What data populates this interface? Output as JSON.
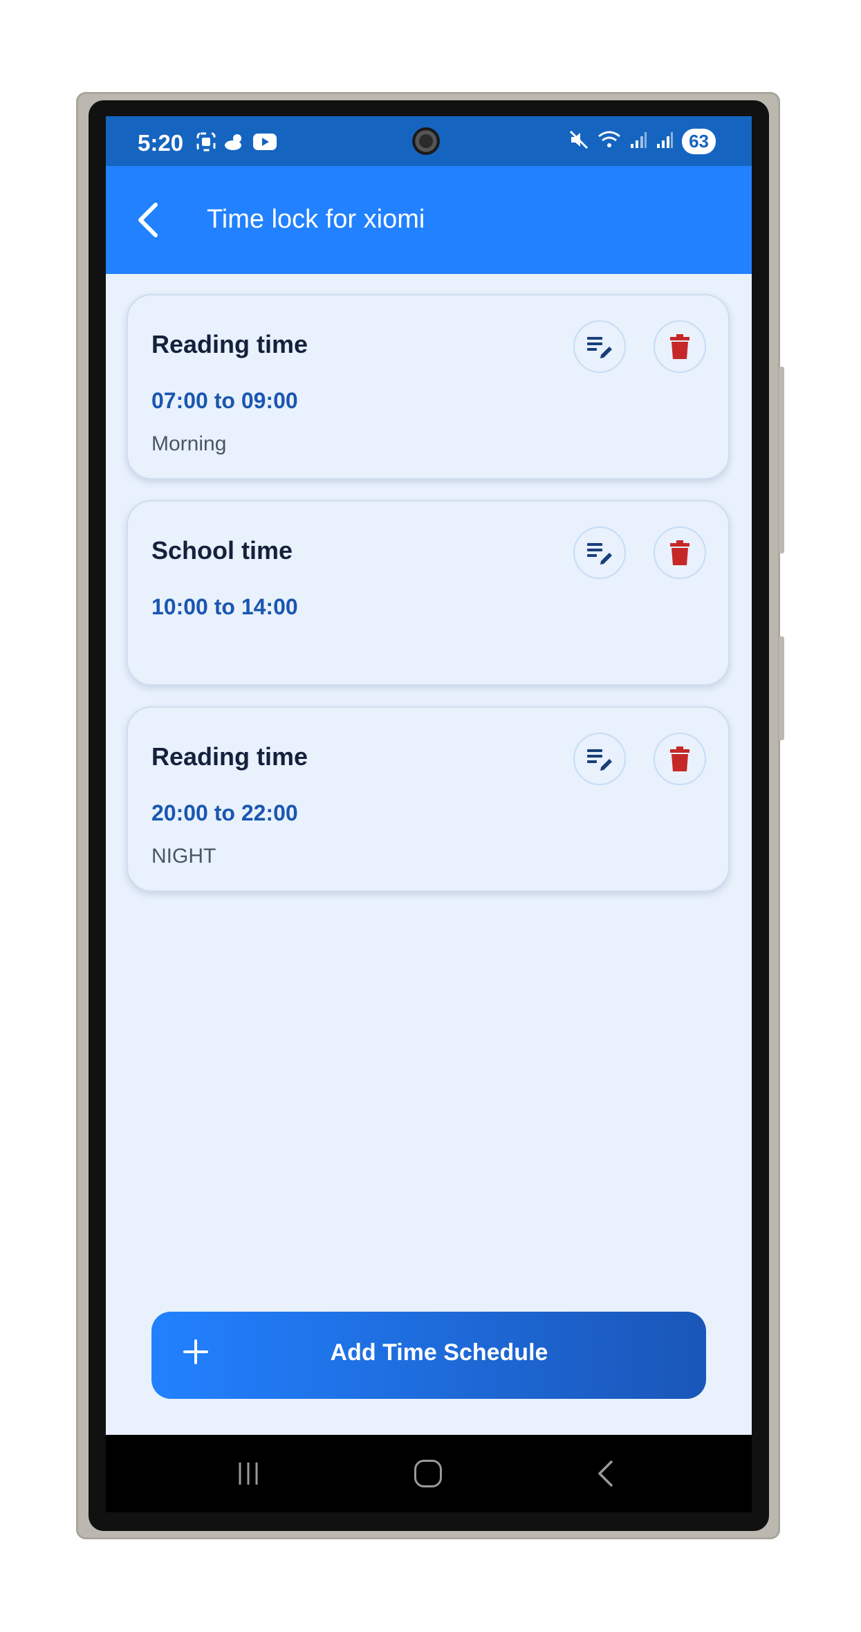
{
  "status_bar": {
    "time": "5:20",
    "left_icons": [
      "screenshot-icon",
      "weather-icon",
      "youtube-icon"
    ],
    "right_icons": [
      "mute-icon",
      "wifi-icon",
      "signal-icon",
      "signal-icon"
    ],
    "battery": "63"
  },
  "app_bar": {
    "title": "Time lock for xiomi",
    "back_icon": "chevron-left-icon",
    "background": "#2281ff"
  },
  "schedules": [
    {
      "title": "Reading time",
      "time_range": "07:00 to 09:00",
      "note": "Morning"
    },
    {
      "title": "School time",
      "time_range": "10:00 to 14:00",
      "note": ""
    },
    {
      "title": "Reading time",
      "time_range": "20:00 to 22:00",
      "note": "NIGHT"
    }
  ],
  "card_actions": {
    "edit_icon": "edit-list-icon",
    "delete_icon": "trash-icon",
    "delete_color": "#c62828"
  },
  "add_button": {
    "label": "Add Time Schedule",
    "icon": "plus-icon"
  },
  "nav_bar": {
    "buttons": [
      "recents-icon",
      "home-icon",
      "back-icon"
    ]
  }
}
